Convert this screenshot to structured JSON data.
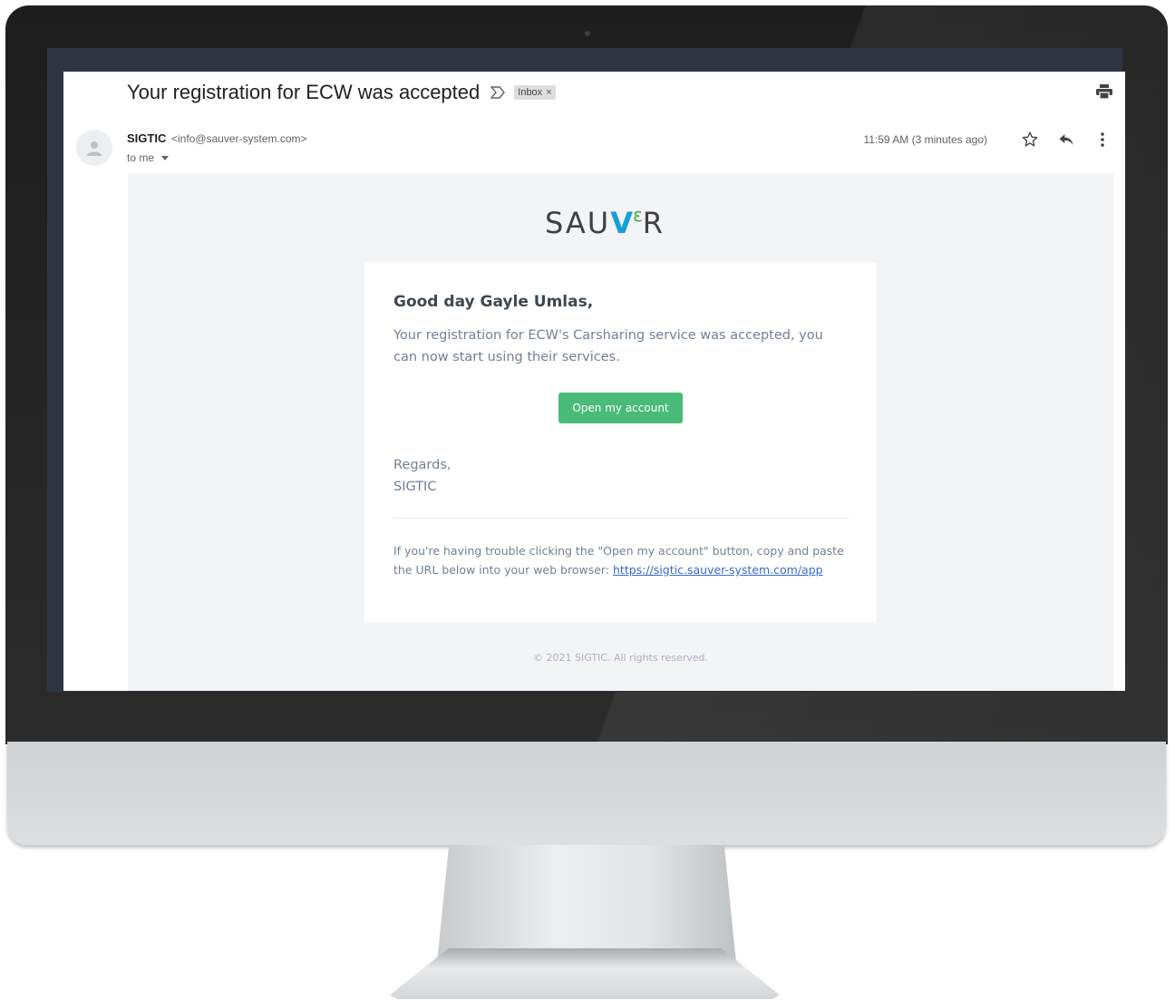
{
  "email": {
    "subject": "Your registration for ECW was accepted",
    "label": "Inbox",
    "label_remove": "×",
    "sender_name": "SIGTIC",
    "sender_email": "<info@sauver-system.com>",
    "to": "to me",
    "timestamp": "11:59 AM (3 minutes ago)"
  },
  "body": {
    "logo": {
      "part1": "SAU",
      "v": "V",
      "e": "ε",
      "part2": "R"
    },
    "greeting": "Good day Gayle Umlas,",
    "message": "Your registration for ECW's Carsharing service was accepted, you can now start using their services.",
    "button_label": "Open my account",
    "regards_line1": "Regards,",
    "regards_line2": "SIGTIC",
    "trouble_text": "If you're having trouble clicking the \"Open my account\" button, copy and paste the URL below into your web browser: ",
    "trouble_link": "https://sigtic.sauver-system.com/app",
    "footer": "© 2021 SIGTIC. All rights reserved."
  },
  "icons": {
    "importance": "importance-marker-icon",
    "print": "print-icon",
    "star": "star-icon",
    "reply": "reply-icon",
    "more": "more-vertical-icon",
    "avatar": "person-icon"
  },
  "colors": {
    "button": "#48bb78",
    "link": "#3869d4",
    "logo_v": "#16a0d8",
    "logo_e": "#3fae49"
  }
}
